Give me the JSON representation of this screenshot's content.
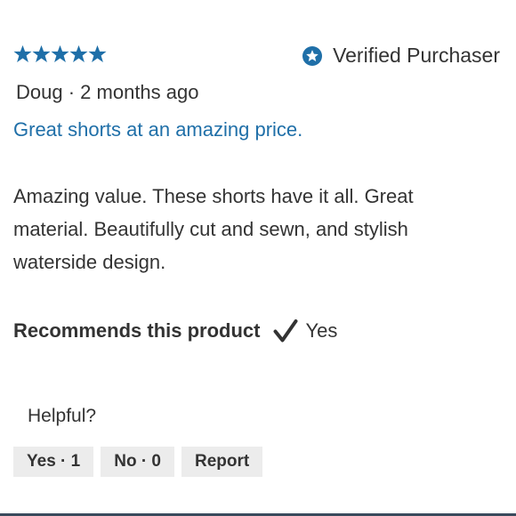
{
  "rating": {
    "stars": 5,
    "max": 5,
    "color": "#1f6fa8",
    "icon": "star-icon"
  },
  "verified": {
    "icon": "verified-star-badge-icon",
    "label": "Verified Purchaser"
  },
  "author": {
    "name": "Doug",
    "separator": "·",
    "date": "2 months ago"
  },
  "review": {
    "title": "Great shorts at an amazing price.",
    "body": "Amazing value. These shorts have it all. Great material. Beautifully cut and sewn, and stylish waterside design."
  },
  "recommendation": {
    "label": "Recommends this product",
    "icon": "checkmark-icon",
    "answer": "Yes"
  },
  "helpful": {
    "label": "Helpful?",
    "buttons": {
      "yes": "Yes · 1",
      "no": "No · 0",
      "report": "Report"
    }
  },
  "colors": {
    "link": "#1f6fa8",
    "text": "#333333",
    "button_bg": "#ececec"
  }
}
